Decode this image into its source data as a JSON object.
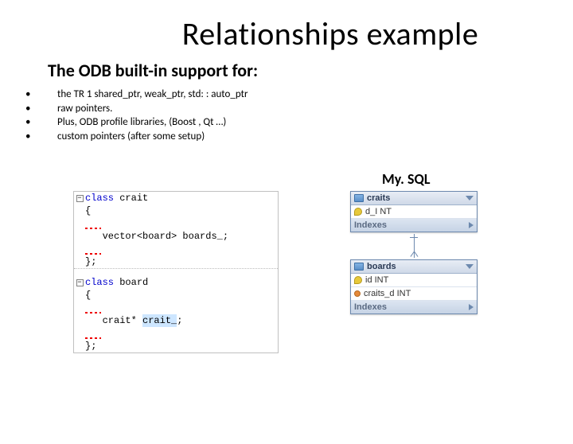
{
  "title": "Relationships example",
  "subtitle": "The ODB built-in support for:",
  "bullets": [
    "the TR 1 shared_ptr, weak_ptr, std: : auto_ptr",
    "raw pointers.",
    "Plus, ODB profile libraries, (Boost , Qt …)",
    "custom pointers (after some setup)"
  ],
  "db_label": "My. SQL",
  "code": {
    "class1_kw": "class",
    "class1_name": " crait",
    "brace_open": "{",
    "member1_type": "vector<board>",
    "member1_name": " boards_;",
    "brace_close": "};",
    "class2_kw": "class",
    "class2_name": " board",
    "member2_type": "crait*",
    "member2_name_pre": " ",
    "member2_name_hl": "crait_",
    "member2_name_post": ";"
  },
  "tables": {
    "t1": {
      "name": "craits",
      "col1": "d_I NT",
      "idx": "Indexes"
    },
    "t2": {
      "name": "boards",
      "col1": "id INT",
      "col2": "craits_d INT",
      "idx": "Indexes"
    }
  }
}
